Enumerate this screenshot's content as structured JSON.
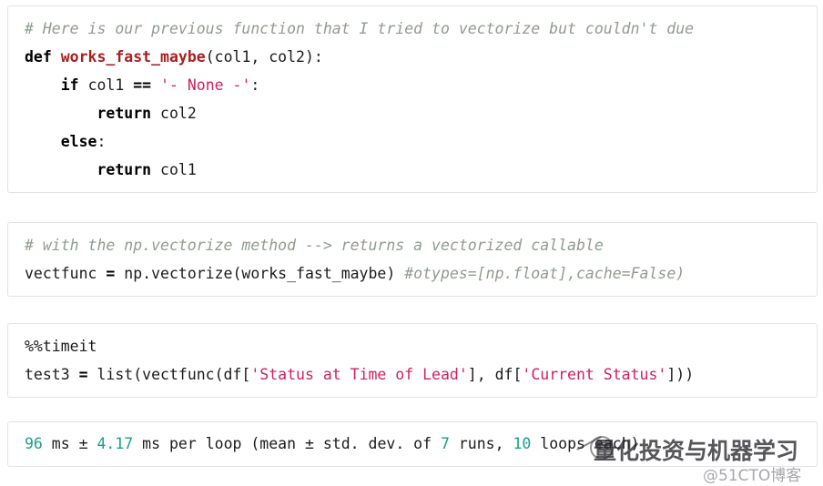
{
  "document": {
    "type": "jupyter-notebook-code-cells",
    "background_color": "#ffffff",
    "cell_border_color": "#e3e3e3"
  },
  "syntax_colors": {
    "comment": "#8f9c8f",
    "keyword": "#000000",
    "function_name": "#a92020",
    "string": "#d02060",
    "number_output": "#1aa08a",
    "plain": "#1b1b1b"
  },
  "cells": [
    {
      "name": "function-definition-cell",
      "lines": [
        {
          "tokens": [
            {
              "t": "cmt",
              "s": "# Here is our previous function that I tried to vectorize but couldn't due"
            }
          ]
        },
        {
          "tokens": [
            {
              "t": "kw",
              "s": "def "
            },
            {
              "t": "fn",
              "s": "works_fast_maybe"
            },
            {
              "t": "plain",
              "s": "(col1, col2):"
            }
          ]
        },
        {
          "tokens": [
            {
              "t": "plain",
              "s": "    "
            },
            {
              "t": "kw",
              "s": "if "
            },
            {
              "t": "plain",
              "s": "col1 "
            },
            {
              "t": "op",
              "s": "=="
            },
            {
              "t": "plain",
              "s": " "
            },
            {
              "t": "str",
              "s": "'- None -'"
            },
            {
              "t": "plain",
              "s": ":"
            }
          ]
        },
        {
          "tokens": [
            {
              "t": "plain",
              "s": "        "
            },
            {
              "t": "kw",
              "s": "return "
            },
            {
              "t": "plain",
              "s": "col2"
            }
          ]
        },
        {
          "tokens": [
            {
              "t": "plain",
              "s": "    "
            },
            {
              "t": "kw",
              "s": "else"
            },
            {
              "t": "plain",
              "s": ":"
            }
          ]
        },
        {
          "tokens": [
            {
              "t": "plain",
              "s": "        "
            },
            {
              "t": "kw",
              "s": "return "
            },
            {
              "t": "plain",
              "s": "col1"
            }
          ]
        }
      ]
    },
    {
      "name": "vectorize-cell",
      "lines": [
        {
          "tokens": [
            {
              "t": "cmt",
              "s": "# with the np.vectorize method --> returns a vectorized callable"
            }
          ]
        },
        {
          "tokens": [
            {
              "t": "plain",
              "s": "vectfunc "
            },
            {
              "t": "op",
              "s": "="
            },
            {
              "t": "plain",
              "s": " np.vectorize(works_fast_maybe) "
            },
            {
              "t": "cmt",
              "s": "#otypes=[np.float],cache=False)"
            }
          ]
        }
      ]
    },
    {
      "name": "timeit-cell",
      "lines": [
        {
          "tokens": [
            {
              "t": "magic",
              "s": "%%timeit"
            }
          ]
        },
        {
          "tokens": [
            {
              "t": "plain",
              "s": "test3 "
            },
            {
              "t": "op",
              "s": "="
            },
            {
              "t": "plain",
              "s": " list(vectfunc(df["
            },
            {
              "t": "str",
              "s": "'Status at Time of Lead'"
            },
            {
              "t": "plain",
              "s": "], df["
            },
            {
              "t": "str",
              "s": "'Current Status'"
            },
            {
              "t": "plain",
              "s": "]))"
            }
          ]
        }
      ]
    },
    {
      "name": "output-cell",
      "lines": [
        {
          "tokens": [
            {
              "t": "num",
              "s": "96"
            },
            {
              "t": "plain",
              "s": " ms ± "
            },
            {
              "t": "num",
              "s": "4.17"
            },
            {
              "t": "plain",
              "s": " ms per loop (mean ± std. dev. of "
            },
            {
              "t": "num",
              "s": "7"
            },
            {
              "t": "plain",
              "s": " runs, "
            },
            {
              "t": "num",
              "s": "10"
            },
            {
              "t": "plain",
              "s": " loops each)"
            }
          ]
        }
      ]
    }
  ],
  "watermarks": {
    "chinese_text": "量化投资与机器学习",
    "site_credit": "@51CTO博客"
  }
}
